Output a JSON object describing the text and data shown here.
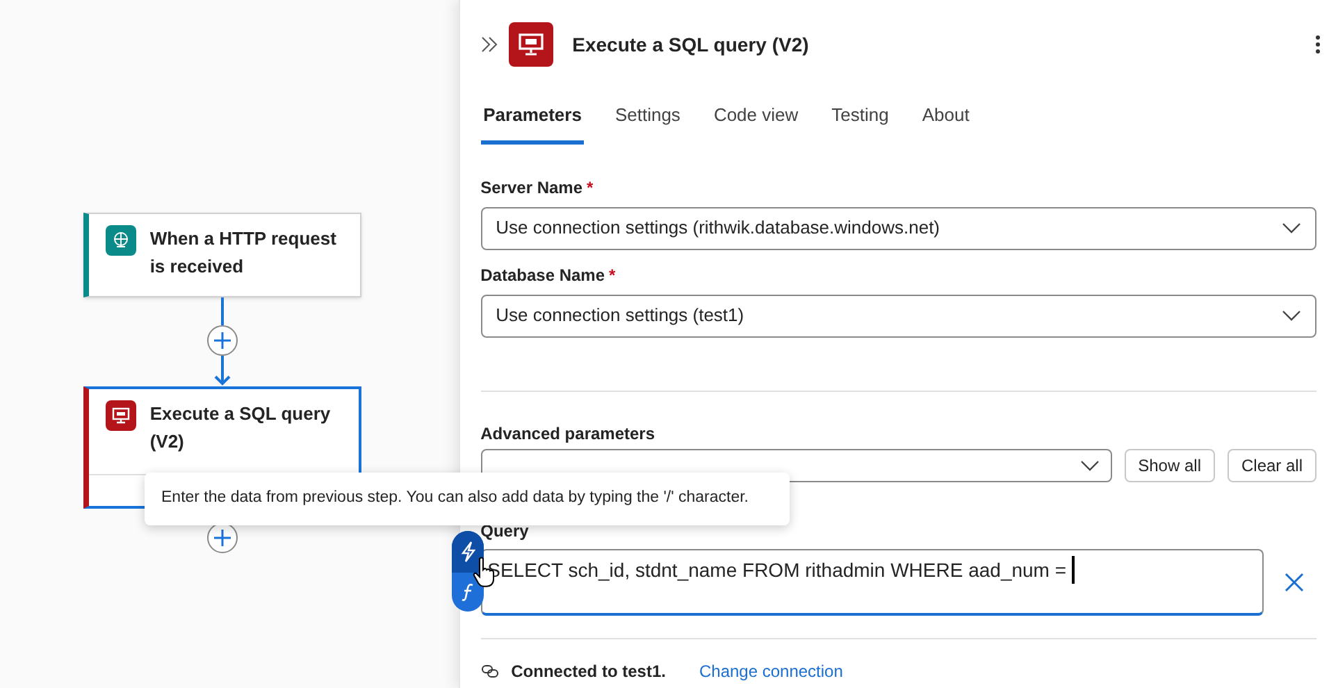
{
  "canvas": {
    "nodes": [
      {
        "kind": "trigger",
        "title": "When a HTTP request is received",
        "color": "#0b8a8a",
        "selected": false
      },
      {
        "kind": "action",
        "title": "Execute a SQL query (V2)",
        "color": "#b4151b",
        "selected": true
      }
    ]
  },
  "panel": {
    "title": "Execute a SQL query (V2)",
    "tabs": [
      {
        "label": "Parameters",
        "selected": true
      },
      {
        "label": "Settings",
        "selected": false
      },
      {
        "label": "Code view",
        "selected": false
      },
      {
        "label": "Testing",
        "selected": false
      },
      {
        "label": "About",
        "selected": false
      }
    ],
    "fields": [
      {
        "label": "Server Name",
        "required_mark": "*",
        "value": "Use connection settings (rithwik.database.windows.net)"
      },
      {
        "label": "Database Name",
        "required_mark": "*",
        "value": "Use connection settings (test1)"
      }
    ],
    "advanced": {
      "label": "Advanced parameters",
      "buttons": [
        "Show all",
        "Clear all"
      ]
    },
    "query": {
      "label": "Query",
      "value": "SELECT sch_id, stdnt_name FROM rithadmin WHERE aad_num ="
    },
    "connection": {
      "text": "Connected to test1.",
      "link": "Change connection"
    }
  },
  "tooltip": {
    "text": "Enter the data from previous step. You can also add data by typing the '/' character."
  }
}
